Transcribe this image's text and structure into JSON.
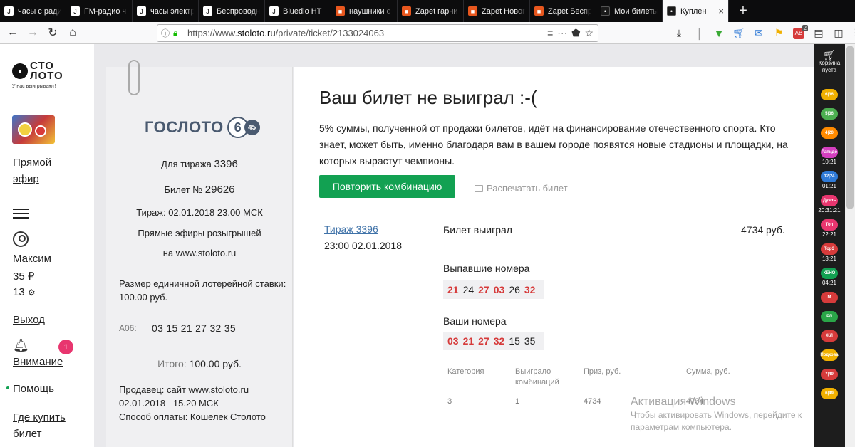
{
  "browser": {
    "tabs": [
      {
        "label": "часы с радио",
        "fav": "w",
        "icon": "favicon-j"
      },
      {
        "label": "FM-радио ч",
        "fav": "w",
        "icon": "favicon-j"
      },
      {
        "label": "часы электр",
        "fav": "w",
        "icon": "favicon-j"
      },
      {
        "label": "Беспроводн",
        "fav": "w",
        "icon": "favicon-j"
      },
      {
        "label": "Bluedio HT",
        "fav": "w",
        "icon": "favicon-j"
      },
      {
        "label": "наушники с",
        "fav": "o",
        "icon": "favicon-aliexpress"
      },
      {
        "label": "Zapet гарни",
        "fav": "o",
        "icon": "favicon-aliexpress"
      },
      {
        "label": "Zapet Новог",
        "fav": "o",
        "icon": "favicon-aliexpress"
      },
      {
        "label": "Zapet Беспр",
        "fav": "o",
        "icon": "favicon-aliexpress"
      },
      {
        "label": "Мои билеты",
        "fav": "b",
        "icon": "favicon-stoloto"
      },
      {
        "label": "Куплен",
        "fav": "b",
        "icon": "favicon-stoloto",
        "active": true
      }
    ],
    "url_prefix": "https://www.",
    "url_domain": "stoloto.ru",
    "url_path": "/private/ticket/2133024063",
    "ext_badge": "2"
  },
  "sidebar": {
    "logo_line1": "СТО",
    "logo_line2": "ЛОТО",
    "slogan": "У нас выигрывают!",
    "live_line1": "Прямой",
    "live_line2": "эфир",
    "user_name": "Максим",
    "balance": "35 ₽",
    "bonus": "13",
    "logout": "Выход",
    "attention": "Внимание",
    "attention_count": "1",
    "help": "Помощь",
    "where_buy_line1": "Где купить",
    "where_buy_line2": "билет"
  },
  "ticket": {
    "brand": "ГОСЛОТО",
    "brand_6": "6",
    "brand_45": "45",
    "draw_label": "Для тиража",
    "draw_no": "3396",
    "ticket_label": "Билет №",
    "ticket_no": "29626",
    "draw_time": "Тираж: 02.01.2018 23.00 МСК",
    "live_text1": "Прямые эфиры розыгрышей",
    "live_text2": "на www.stoloto.ru",
    "stake_line1": "Размер единичной лотерейной ставки:",
    "stake_line2": "100.00 руб.",
    "combo_label": "А06:",
    "combo_numbers": "03 15 21 27 32 35",
    "total_label": "Итого:",
    "total_value": "100.00 руб.",
    "seller": "Продавец: сайт www.stoloto.ru",
    "sold_at": "02.01.2018   15.20 МСК",
    "payment": "Способ оплаты: Кошелек Столото"
  },
  "result": {
    "title": "Ваш билет не выиграл :-(",
    "description": "5% суммы, полученной от продажи билетов, идёт на финансирование отечественного спорта. Кто знает, может быть, именно благодаря вам в вашем городе появятся новые стадионы и площадки, на которых вырастут чемпионы.",
    "repeat_button": "Повторить комбинацию",
    "print_link": "Распечатать билет",
    "draw_link": "Тираж 3396",
    "draw_datetime": "23:00 02.01.2018",
    "won_label": "Билет выиграл",
    "won_amount": "4734 руб.",
    "drawn_label": "Выпавшие номера",
    "drawn_numbers": [
      {
        "n": "21",
        "hit": true
      },
      {
        "n": "24",
        "hit": false
      },
      {
        "n": "27",
        "hit": true
      },
      {
        "n": "03",
        "hit": true
      },
      {
        "n": "26",
        "hit": false
      },
      {
        "n": "32",
        "hit": true
      }
    ],
    "your_label": "Ваши номера",
    "your_numbers": [
      {
        "n": "03",
        "hit": true
      },
      {
        "n": "21",
        "hit": true
      },
      {
        "n": "27",
        "hit": true
      },
      {
        "n": "32",
        "hit": true
      },
      {
        "n": "15",
        "hit": false
      },
      {
        "n": "35",
        "hit": false
      }
    ],
    "table": {
      "headers": [
        "Категория",
        "Выиграло комбинаций",
        "Приз, руб.",
        "Сумма, руб."
      ],
      "rows": [
        [
          "3",
          "1",
          "4734",
          "4734"
        ]
      ]
    }
  },
  "watermark": {
    "line1": "Активация Windows",
    "line2": "Чтобы активировать Windows, перейдите к",
    "line3": "параметрам компьютера."
  },
  "right_panel": {
    "cart_line1": "Корзина",
    "cart_line2": "пуста",
    "items": [
      {
        "label": "6|36",
        "time": "",
        "color": "#f0b000"
      },
      {
        "label": "5|36",
        "time": "",
        "color": "#4caf50"
      },
      {
        "label": "4|20",
        "time": "",
        "color": "#ff8a00"
      },
      {
        "label": "Рапидо",
        "time": "10:21",
        "color": "#d43fbf"
      },
      {
        "label": "12|24",
        "time": "01:21",
        "color": "#2f7ad6"
      },
      {
        "label": "Дуэль",
        "time": "20:31:21",
        "color": "#e8366f"
      },
      {
        "label": "Топ",
        "time": "22:21",
        "color": "#e8366f"
      },
      {
        "label": "Top3",
        "time": "13:21",
        "color": "#d63b3b"
      },
      {
        "label": "КЕНО",
        "time": "04:21",
        "color": "#12a152"
      },
      {
        "label": "M",
        "time": "",
        "color": "#d63b3b"
      },
      {
        "label": "РЛ",
        "time": "",
        "color": "#2aa648"
      },
      {
        "label": "ЖЛ",
        "time": "",
        "color": "#d63b3b"
      },
      {
        "label": "Подкова",
        "time": "",
        "color": "#f0b000"
      },
      {
        "label": "7|49",
        "time": "",
        "color": "#d63b3b"
      },
      {
        "label": "6|49",
        "time": "",
        "color": "#f0b000"
      }
    ]
  }
}
